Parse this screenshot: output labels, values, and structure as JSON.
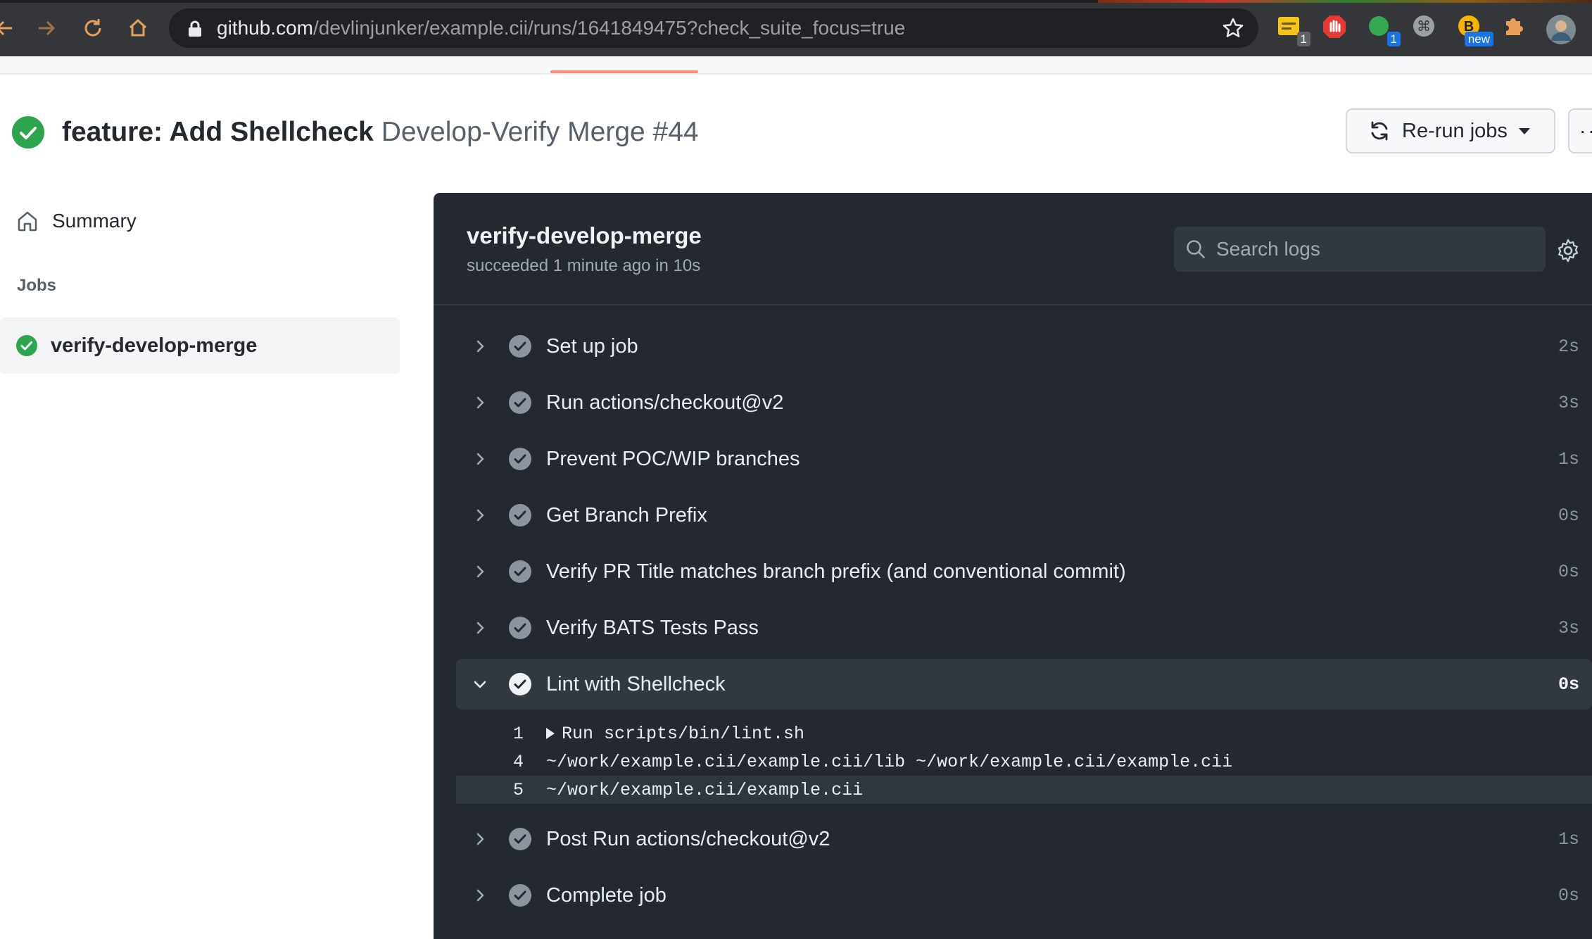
{
  "browser": {
    "url_host": "github.com",
    "url_path": "/devlinjunker/example.cii/runs/1641849475?check_suite_focus=true",
    "extensions": [
      {
        "icon": "notes-extension-icon",
        "badge": "1",
        "badge_color": "#5f6368"
      },
      {
        "icon": "adblock-extension-icon",
        "badge": "",
        "badge_color": ""
      },
      {
        "icon": "green-circle-extension-icon",
        "badge": "1",
        "badge_color": "#1a73e8"
      },
      {
        "icon": "command-extension-icon",
        "badge": "",
        "badge_color": ""
      },
      {
        "icon": "b-extension-icon",
        "badge": "new",
        "badge_color": "#1a73e8"
      },
      {
        "icon": "puzzle-extensions-icon",
        "badge": "",
        "badge_color": ""
      },
      {
        "icon": "profile-avatar",
        "badge": "",
        "badge_color": ""
      }
    ]
  },
  "header": {
    "commit_title": "feature: Add Shellcheck",
    "workflow_run": "Develop-Verify Merge #44",
    "rerun_label": "Re-run jobs",
    "status": "success"
  },
  "sidebar": {
    "summary_label": "Summary",
    "jobs_heading": "Jobs",
    "jobs": [
      {
        "label": "verify-develop-merge",
        "status": "success"
      }
    ]
  },
  "job": {
    "name": "verify-develop-merge",
    "meta": "succeeded 1 minute ago in 10s",
    "search_placeholder": "Search logs",
    "steps": [
      {
        "name": "Set up job",
        "duration": "2s",
        "expanded": false
      },
      {
        "name": "Run actions/checkout@v2",
        "duration": "3s",
        "expanded": false
      },
      {
        "name": "Prevent POC/WIP branches",
        "duration": "1s",
        "expanded": false
      },
      {
        "name": "Get Branch Prefix",
        "duration": "0s",
        "expanded": false
      },
      {
        "name": "Verify PR Title matches branch prefix (and conventional commit)",
        "duration": "0s",
        "expanded": false
      },
      {
        "name": "Verify BATS Tests Pass",
        "duration": "3s",
        "expanded": false
      },
      {
        "name": "Lint with Shellcheck",
        "duration": "0s",
        "expanded": true,
        "log": [
          {
            "line": "1",
            "text": "Run scripts/bin/lint.sh",
            "collapsible": true,
            "highlighted": false
          },
          {
            "line": "4",
            "text": "~/work/example.cii/example.cii/lib ~/work/example.cii/example.cii",
            "collapsible": false,
            "highlighted": false
          },
          {
            "line": "5",
            "text": "~/work/example.cii/example.cii",
            "collapsible": false,
            "highlighted": true
          }
        ]
      },
      {
        "name": "Post Run actions/checkout@v2",
        "duration": "1s",
        "expanded": false
      },
      {
        "name": "Complete job",
        "duration": "0s",
        "expanded": false
      }
    ]
  },
  "colors": {
    "success_green": "#2da44e",
    "panel_bg": "#24292f",
    "accent_underline": "#fd8c73"
  }
}
